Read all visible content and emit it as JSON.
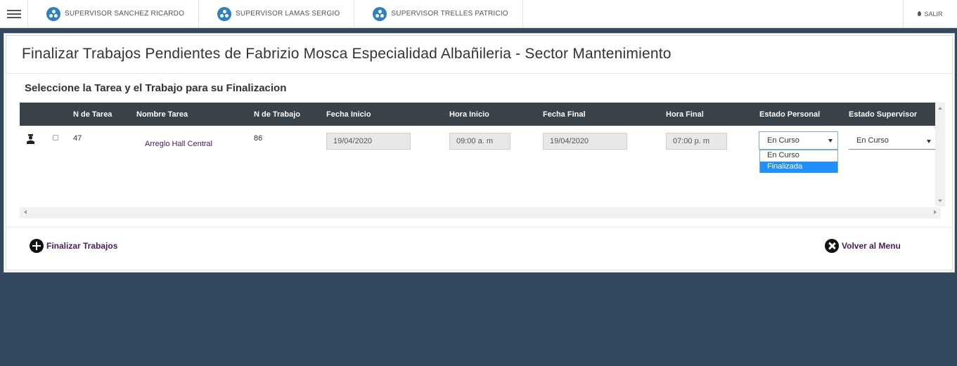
{
  "topbar": {
    "supervisors": [
      {
        "label": "SUPERVISOR SANCHEZ RICARDO",
        "icon": "users-icon"
      },
      {
        "label": "SUPERVISOR LAMAS SERGIO",
        "icon": "users-icon"
      },
      {
        "label": "SUPERVISOR TRELLES PATRICIO",
        "icon": "users-icon"
      }
    ],
    "logout_label": "SALIR"
  },
  "panel": {
    "title": "Finalizar Trabajos Pendientes de Fabrizio Mosca Especialidad Albañileria - Sector Mantenimiento",
    "subtitle": "Seleccione la Tarea y el Trabajo para su Finalizacion"
  },
  "grid": {
    "columns": [
      "N de Tarea",
      "Nombre Tarea",
      "N de Trabajo",
      "Fecha Inicio",
      "Hora Inicio",
      "Fecha Final",
      "Hora Final",
      "Estado Personal",
      "Estado Supervisor"
    ],
    "rows": [
      {
        "n_tarea": "47",
        "nombre_tarea": "Arreglo Hall Central",
        "n_trabajo": "86",
        "fecha_inicio": "19/04/2020",
        "hora_inicio": "09:00 a. m",
        "fecha_final": "19/04/2020",
        "hora_final": "07:00 p. m",
        "estado_personal": "En Curso",
        "estado_personal_options": [
          "En Curso",
          "Finalizada"
        ],
        "estado_personal_highlighted": "Finalizada",
        "estado_supervisor": "En Curso"
      }
    ]
  },
  "actions": {
    "finalizar": "Finalizar Trabajos",
    "volver": "Volver al Menu"
  },
  "colors": {
    "background": "#34495e",
    "header": "#394249",
    "link": "#4a1a5a",
    "highlight": "#1e90ff",
    "user_icon": "#2f7fc1"
  }
}
